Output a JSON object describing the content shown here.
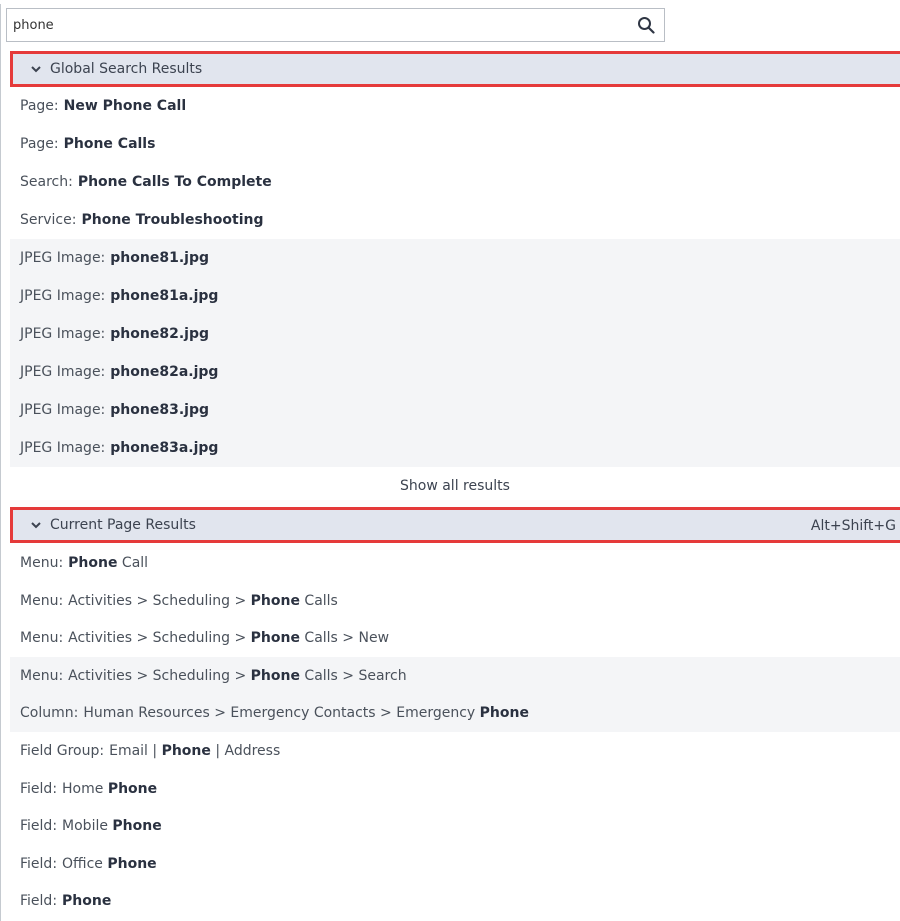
{
  "search": {
    "value": "phone",
    "placeholder": ""
  },
  "global_section": {
    "title": "Global Search Results"
  },
  "global_results": [
    {
      "label": "Page:",
      "value": "New Phone Call"
    },
    {
      "label": "Page:",
      "value": "Phone Calls"
    },
    {
      "label": "Search:",
      "value": "Phone Calls To Complete"
    },
    {
      "label": "Service:",
      "value": "Phone Troubleshooting"
    },
    {
      "label": "JPEG Image:",
      "value": "phone81.jpg"
    },
    {
      "label": "JPEG Image:",
      "value": "phone81a.jpg"
    },
    {
      "label": "JPEG Image:",
      "value": "phone82.jpg"
    },
    {
      "label": "JPEG Image:",
      "value": "phone82a.jpg"
    },
    {
      "label": "JPEG Image:",
      "value": "phone83.jpg"
    },
    {
      "label": "JPEG Image:",
      "value": "phone83a.jpg"
    }
  ],
  "show_all": "Show all results",
  "current_section": {
    "title": "Current Page Results",
    "shortcut": "Alt+Shift+G"
  },
  "current_results": [
    {
      "label": "Menu:",
      "pre": "",
      "bold": "Phone",
      "post": " Call"
    },
    {
      "label": "Menu:",
      "pre": "Activities > Scheduling > ",
      "bold": "Phone",
      "post": " Calls"
    },
    {
      "label": "Menu:",
      "pre": "Activities > Scheduling > ",
      "bold": "Phone",
      "post": " Calls > New"
    },
    {
      "label": "Menu:",
      "pre": "Activities > Scheduling > ",
      "bold": "Phone",
      "post": " Calls > Search"
    },
    {
      "label": "Column:",
      "pre": "Human Resources > Emergency Contacts > Emergency ",
      "bold": "Phone",
      "post": ""
    },
    {
      "label": "Field Group:",
      "pre": "Email | ",
      "bold": "Phone",
      "post": " | Address"
    },
    {
      "label": "Field:",
      "pre": "Home ",
      "bold": "Phone",
      "post": ""
    },
    {
      "label": "Field:",
      "pre": "Mobile ",
      "bold": "Phone",
      "post": ""
    },
    {
      "label": "Field:",
      "pre": "Office ",
      "bold": "Phone",
      "post": ""
    },
    {
      "label": "Field:",
      "pre": "",
      "bold": "Phone",
      "post": ""
    }
  ],
  "colors": {
    "highlight_border": "#e53a3a",
    "header_bg": "#e1e5ee"
  }
}
